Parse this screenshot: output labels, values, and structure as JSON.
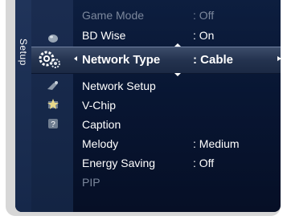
{
  "sidebar": {
    "tab_label": "Setup",
    "icons": [
      "picture-icon",
      "setup-gear-icon",
      "channel-icon",
      "input-icon",
      "support-icon"
    ]
  },
  "menu": {
    "items": [
      {
        "label": "Game Mode",
        "value": ": Off",
        "state": "disabled"
      },
      {
        "label": "BD Wise",
        "value": ": On",
        "state": "normal"
      },
      {
        "label": "Network Type",
        "value": ": Cable",
        "state": "selected"
      },
      {
        "label": "Network Setup",
        "value": "",
        "state": "normal"
      },
      {
        "label": "V-Chip",
        "value": "",
        "state": "normal"
      },
      {
        "label": "Caption",
        "value": "",
        "state": "normal"
      },
      {
        "label": "Melody",
        "value": ": Medium",
        "state": "normal"
      },
      {
        "label": "Energy Saving",
        "value": ": Off",
        "state": "normal"
      },
      {
        "label": "PIP",
        "value": "",
        "state": "disabled"
      }
    ]
  },
  "colors": {
    "background": "#081633",
    "highlight": "#2b3a57",
    "text": "#ffffff",
    "disabled_text": "#7b879c"
  }
}
